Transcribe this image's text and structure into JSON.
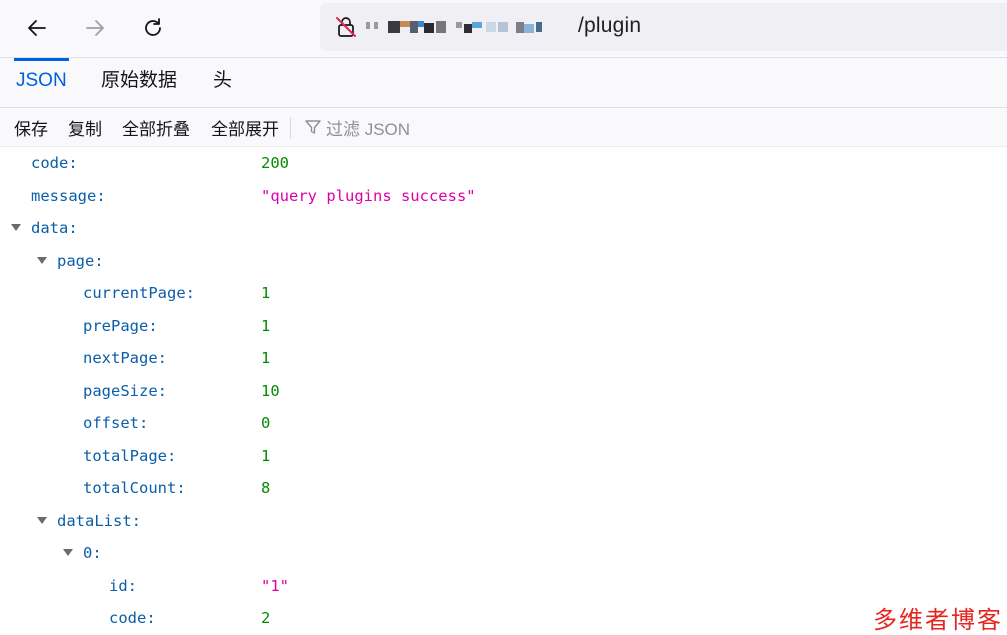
{
  "browser": {
    "url_visible": "/plugin",
    "back_icon": "arrow-left-icon",
    "forward_icon": "arrow-right-icon",
    "reload_icon": "reload-icon",
    "security_icon": "insecure-lock-icon"
  },
  "viewer": {
    "tabs": [
      {
        "label": "JSON",
        "active": true
      },
      {
        "label": "原始数据",
        "active": false
      },
      {
        "label": "头",
        "active": false
      }
    ],
    "actions": {
      "save": "保存",
      "copy": "复制",
      "collapse_all": "全部折叠",
      "expand_all": "全部展开",
      "filter_placeholder": "过滤 JSON"
    }
  },
  "json_tree": {
    "rows": [
      {
        "key": "code:",
        "value": "200",
        "type": "number"
      },
      {
        "key": "message:",
        "value": "\"query plugins success\"",
        "type": "string"
      },
      {
        "key": "data:",
        "expanded": true
      },
      {
        "key": "page:",
        "expanded": true
      },
      {
        "key": "currentPage:",
        "value": "1",
        "type": "number"
      },
      {
        "key": "prePage:",
        "value": "1",
        "type": "number"
      },
      {
        "key": "nextPage:",
        "value": "1",
        "type": "number"
      },
      {
        "key": "pageSize:",
        "value": "10",
        "type": "number"
      },
      {
        "key": "offset:",
        "value": "0",
        "type": "number"
      },
      {
        "key": "totalPage:",
        "value": "1",
        "type": "number"
      },
      {
        "key": "totalCount:",
        "value": "8",
        "type": "number"
      },
      {
        "key": "dataList:",
        "expanded": true
      },
      {
        "key": "0:",
        "expanded": true
      },
      {
        "key": "id:",
        "value": "\"1\"",
        "type": "string"
      },
      {
        "key": "code:",
        "value": "2",
        "type": "number"
      }
    ]
  },
  "watermark": "多维者博客",
  "colors": {
    "accent": "#0060df",
    "key": "#0b5ea8",
    "number": "#058b00",
    "string": "#dd00a9",
    "watermark": "#e5251f"
  }
}
